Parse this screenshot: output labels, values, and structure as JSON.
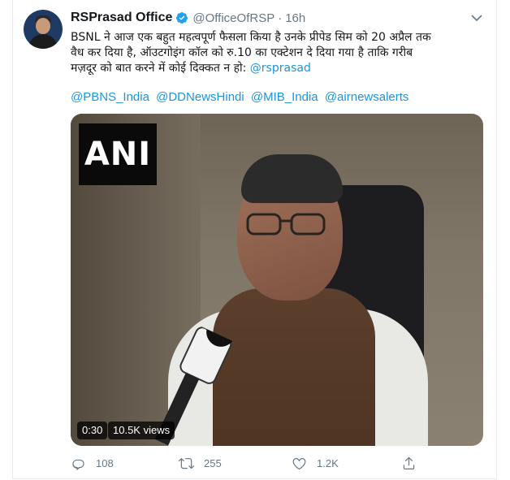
{
  "tweet": {
    "display_name": "RSPrasad Office",
    "handle": "@OfficeOfRSP",
    "separator": "·",
    "time": "16h",
    "text_lines": [
      "BSNL ने आज एक बहुत महत्वपूर्ण फैसला किया है उनके  प्रीपेड सिम को 20 अप्रैल तक",
      "वैध कर दिया है, ऑउटगोइंग कॉल को रु.10 का एक्टेशन दे दिया गया है ताकि गरीब",
      "मज़दूर को बात करने में कोई दिक्कत न हो:"
    ],
    "inline_mention": "@rsprasad",
    "tags": [
      "@PBNS_India",
      "@DDNewsHindi",
      "@MIB_India",
      "@airnewsalerts"
    ]
  },
  "media": {
    "logo_text": "ANI",
    "duration": "0:30",
    "views": "10.5K views"
  },
  "actions": {
    "replies": "108",
    "retweets": "255",
    "likes": "1.2K"
  },
  "icons": {
    "verified": "verified-badge-icon",
    "caret": "chevron-down-icon",
    "reply": "reply-icon",
    "retweet": "retweet-icon",
    "like": "heart-icon",
    "share": "share-icon"
  },
  "colors": {
    "link": "#1b95e0",
    "muted": "#657786",
    "verified": "#1da1f2"
  }
}
